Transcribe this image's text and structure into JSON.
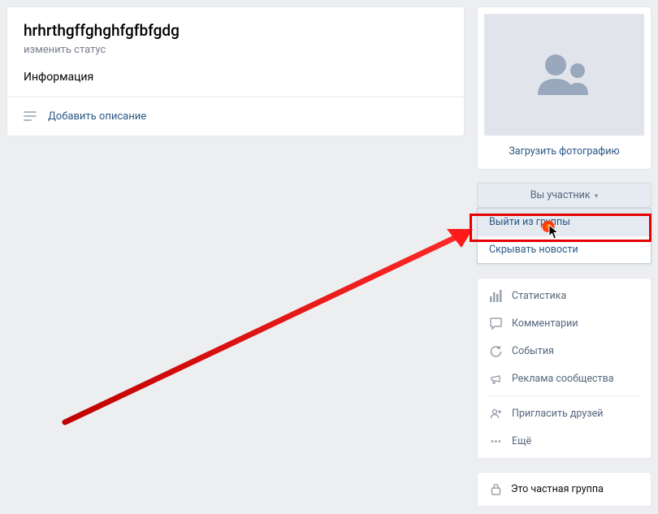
{
  "header": {
    "title": "hrhrthgffghghfgfbfgdg",
    "status_link": "изменить статус",
    "info_label": "Информация",
    "add_description": "Добавить описание"
  },
  "photo": {
    "upload_label": "Загрузить фотографию"
  },
  "member_button": {
    "label": "Вы участник"
  },
  "dropdown": {
    "leave": "Выйти из группы",
    "hide_news": "Скрывать новости"
  },
  "nav": {
    "stats": "Статистика",
    "comments": "Комментарии",
    "events": "События",
    "ads": "Реклама сообщества",
    "invite": "Пригласить друзей",
    "more": "Ещё"
  },
  "privacy": {
    "label": "Это частная группа"
  }
}
